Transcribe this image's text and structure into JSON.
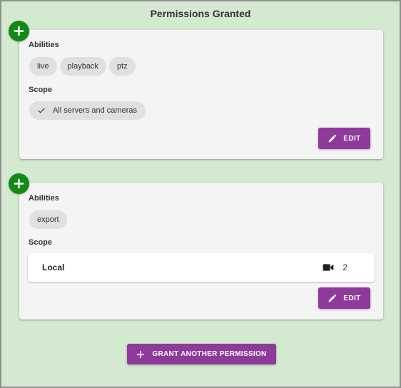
{
  "page": {
    "title": "Permissions Granted",
    "accent_color": "#8e3a9a",
    "add_fab_color": "#138a16",
    "background_color": "#d4ead0"
  },
  "permissions": [
    {
      "abilities_label": "Abilities",
      "abilities": [
        "live",
        "playback",
        "ptz"
      ],
      "scope_label": "Scope",
      "scope_chip": {
        "icon": "check-icon",
        "label": "All servers and cameras"
      },
      "add_icon": "plus-icon",
      "edit_label": "EDIT",
      "edit_icon": "pencil-icon"
    },
    {
      "abilities_label": "Abilities",
      "abilities": [
        "export"
      ],
      "scope_label": "Scope",
      "scope_row": {
        "name": "Local",
        "icon": "video-camera-icon",
        "count": "2"
      },
      "add_icon": "plus-icon",
      "edit_label": "EDIT",
      "edit_icon": "pencil-icon"
    }
  ],
  "footer": {
    "grant_label": "GRANT ANOTHER PERMISSION",
    "grant_icon": "plus-icon"
  }
}
